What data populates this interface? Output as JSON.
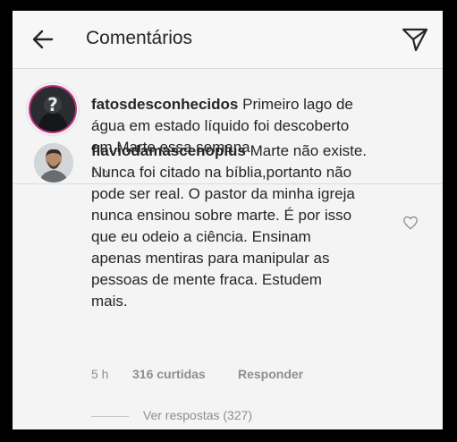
{
  "header": {
    "title": "Comentários",
    "back_icon": "arrow-left-icon",
    "send_icon": "paper-plane-icon"
  },
  "caption": {
    "username": "fatosdesconhecidos",
    "lines": [
      "Primeiro lago de",
      "água em estado líquido foi descoberto",
      "em Marte essa semana."
    ],
    "time": "5 h"
  },
  "comment": {
    "username": "flaviodamascenoplus",
    "lines": [
      "Marte não existe.",
      "Nunca foi citado na bíblia,portanto não",
      "pode ser real. O pastor da minha igreja",
      "nunca ensinou sobre marte. É por isso",
      "que eu odeio a ciência. Ensinam",
      "apenas mentiras para manipular as",
      "pessoas de mente fraca. Estudem",
      "mais."
    ],
    "time": "5 h",
    "likes": "316 curtidas",
    "reply": "Responder",
    "view_replies": "Ver respostas (327)",
    "like_icon": "heart-outline-icon"
  },
  "colors": {
    "background": "#f4f4f4",
    "text": "#262626",
    "secondary_text": "#8e8e8e",
    "story_ring": "#c13584"
  }
}
